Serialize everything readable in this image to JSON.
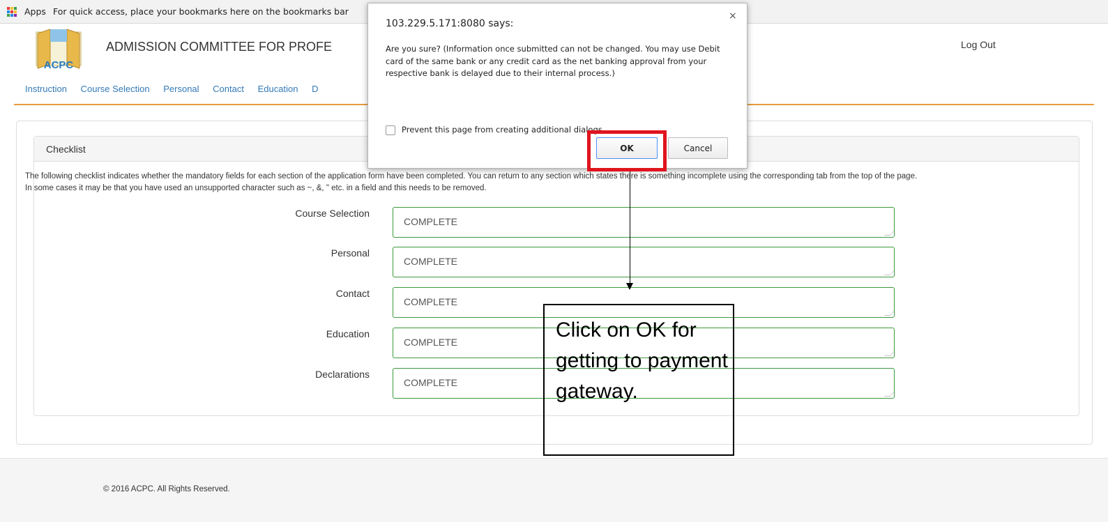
{
  "bookmarks_bar": {
    "apps_label": "Apps",
    "hint": "For quick access, place your bookmarks here on the bookmarks bar",
    "apps_icon_colors": [
      "#e53935",
      "#fbc02d",
      "#43a047",
      "#1e88e5",
      "#e53935",
      "#fbc02d",
      "#43a047",
      "#1e88e5",
      "#8e24aa"
    ]
  },
  "header": {
    "logo_text": "ACPC",
    "title": "ADMISSION COMMITTEE FOR PROFE",
    "logout_label": "Log Out"
  },
  "nav": {
    "items": [
      "Instruction",
      "Course Selection",
      "Personal",
      "Contact",
      "Education",
      "D"
    ]
  },
  "checklist": {
    "title": "Checklist",
    "description_line1": "The following checklist indicates whether the mandatory fields for each section of the application form have been completed. You can return to any section which states there is something incomplete using the corresponding tab from the top of the page.",
    "description_line2": "In some cases it may be that you have used an unsupported character such as ~, &, \" etc. in a field and this needs to be removed.",
    "rows": [
      {
        "label": "Course Selection",
        "status": "COMPLETE"
      },
      {
        "label": "Personal",
        "status": "COMPLETE"
      },
      {
        "label": "Contact",
        "status": "COMPLETE"
      },
      {
        "label": "Education",
        "status": "COMPLETE"
      },
      {
        "label": "Declarations",
        "status": "COMPLETE"
      }
    ]
  },
  "footer": {
    "copyright": "© 2016 ACPC. All Rights Reserved."
  },
  "dialog": {
    "title": "103.229.5.171:8080 says:",
    "close_glyph": "×",
    "message": "Are you sure? (Information once submitted can not be changed. You may use Debit card of the same bank or any credit card as the net banking approval from your respective bank is delayed due to their internal process.)",
    "prevent_label": "Prevent this page from creating additional dialogs.",
    "ok_label": "OK",
    "cancel_label": "Cancel"
  },
  "annotation": {
    "callout_text": "Click on OK for getting to payment gateway.",
    "highlight_color": "#e0141e"
  },
  "colors": {
    "nav_link": "#337ab7",
    "nav_divider": "#e69a3c",
    "status_border": "#3c9a3c"
  }
}
